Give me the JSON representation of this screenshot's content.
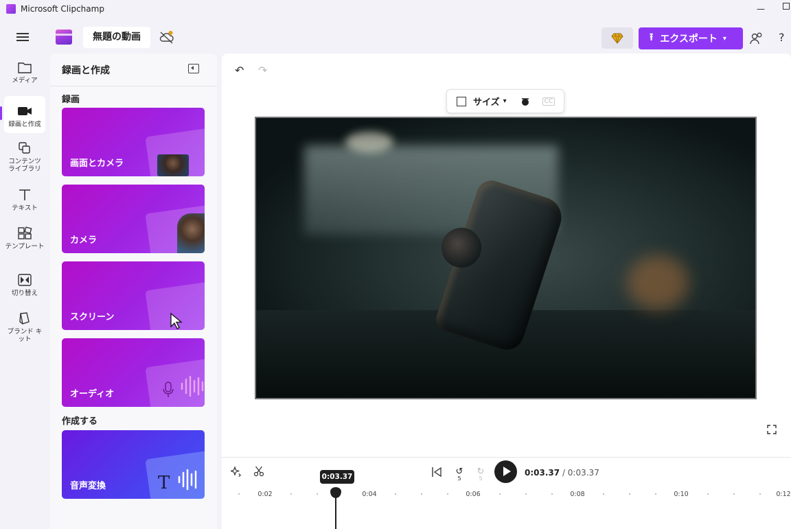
{
  "window": {
    "title": "Microsoft Clipchamp"
  },
  "header": {
    "project_name": "無題の動画",
    "export_label": "エクスポート"
  },
  "rail": {
    "items": [
      {
        "label": "メディア",
        "icon": "folder-icon"
      },
      {
        "label": "録画と作成",
        "icon": "video-camera-icon",
        "active": true
      },
      {
        "label": "コンテンツ ライブラリ",
        "icon": "content-library-icon"
      },
      {
        "label": "テキスト",
        "icon": "text-icon"
      },
      {
        "label": "テンプレート",
        "icon": "templates-icon"
      },
      {
        "label": "切り替え",
        "icon": "transitions-icon"
      },
      {
        "label": "ブランド キット",
        "icon": "brand-kit-icon"
      }
    ]
  },
  "panel": {
    "title": "録画と作成",
    "record_section": "録画",
    "create_section": "作成する",
    "cards": [
      {
        "label": "画面とカメラ"
      },
      {
        "label": "カメラ"
      },
      {
        "label": "スクリーン"
      },
      {
        "label": "オーディオ"
      },
      {
        "label": "音声変換"
      }
    ]
  },
  "toolbar": {
    "size_label": "サイズ"
  },
  "timeline": {
    "current_time": "0:03.37",
    "total_time": "/ 0:03.37",
    "playhead_time": "0:03.37",
    "rewind_label": "5",
    "forward_label": "5",
    "ruler": [
      "0:02",
      "0:04",
      "0:06",
      "0:08",
      "0:10",
      "0:12"
    ]
  },
  "colors": {
    "accent": "#8f37f5",
    "card": "#a321e0"
  }
}
